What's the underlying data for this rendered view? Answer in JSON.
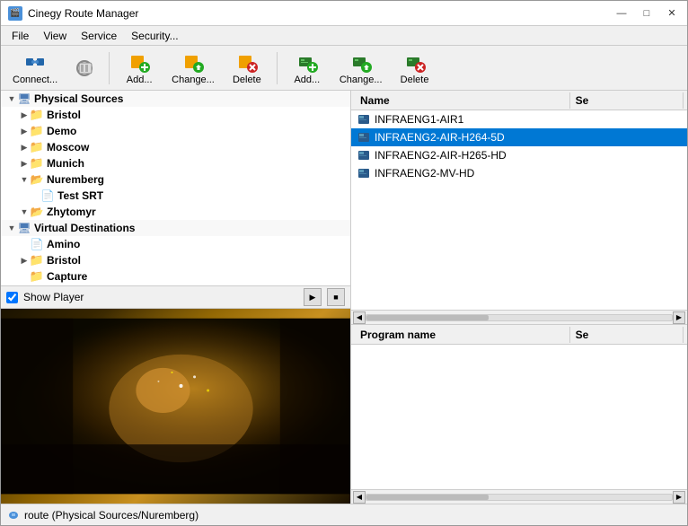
{
  "window": {
    "title": "Cinegy Route Manager",
    "icon": "🎬"
  },
  "titlebar_controls": {
    "minimize": "—",
    "maximize": "□",
    "close": "✕"
  },
  "menubar": {
    "items": [
      "File",
      "View",
      "Service",
      "Security..."
    ]
  },
  "toolbar": {
    "group1": [
      {
        "id": "connect",
        "label": "Connect...",
        "icon": "🔌"
      },
      {
        "id": "refresh",
        "label": "",
        "icon": "🔄"
      }
    ],
    "group2": [
      {
        "id": "add1",
        "label": "Add...",
        "icon": "➕"
      },
      {
        "id": "change1",
        "label": "Change...",
        "icon": "✏️"
      },
      {
        "id": "delete1",
        "label": "Delete",
        "icon": "🗑️"
      }
    ],
    "group3": [
      {
        "id": "add2",
        "label": "Add...",
        "icon": "➕"
      },
      {
        "id": "change2",
        "label": "Change...",
        "icon": "✏️"
      },
      {
        "id": "delete2",
        "label": "Delete",
        "icon": "🗑️"
      }
    ]
  },
  "tree": {
    "items": [
      {
        "id": "physical-sources",
        "label": "Physical Sources",
        "level": 0,
        "type": "root",
        "expanded": true
      },
      {
        "id": "bristol",
        "label": "Bristol",
        "level": 1,
        "type": "folder",
        "expanded": true
      },
      {
        "id": "demo",
        "label": "Demo",
        "level": 1,
        "type": "folder",
        "expanded": false
      },
      {
        "id": "moscow",
        "label": "Moscow",
        "level": 1,
        "type": "folder",
        "expanded": false
      },
      {
        "id": "munich",
        "label": "Munich",
        "level": 1,
        "type": "folder",
        "expanded": true
      },
      {
        "id": "nuremberg",
        "label": "Nuremberg",
        "level": 1,
        "type": "folder",
        "expanded": true,
        "selected": true
      },
      {
        "id": "test-srt",
        "label": "Test SRT",
        "level": 1,
        "type": "item",
        "expanded": false
      },
      {
        "id": "zhytomyr",
        "label": "Zhytomyr",
        "level": 1,
        "type": "folder",
        "expanded": true
      },
      {
        "id": "virtual-destinations",
        "label": "Virtual Destinations",
        "level": 0,
        "type": "root",
        "expanded": true
      },
      {
        "id": "amino",
        "label": "Amino",
        "level": 1,
        "type": "item",
        "expanded": false
      },
      {
        "id": "bristol2",
        "label": "Bristol",
        "level": 1,
        "type": "folder",
        "expanded": false
      },
      {
        "id": "capture",
        "label": "Capture",
        "level": 1,
        "type": "item",
        "expanded": false
      }
    ]
  },
  "show_player": {
    "label": "Show Player",
    "checked": true,
    "play_icon": "▶",
    "stop_icon": "■"
  },
  "right_panel": {
    "columns": [
      {
        "id": "name",
        "label": "Name"
      },
      {
        "id": "se",
        "label": "Se"
      }
    ],
    "items": [
      {
        "id": "infraeng1-air1",
        "label": "INFRAENG1-AIR1",
        "selected": false
      },
      {
        "id": "infraeng2-air-h264-5d",
        "label": "INFRAENG2-AIR-H264-5D",
        "selected": true
      },
      {
        "id": "infraeng2-air-h265-hd",
        "label": "INFRAENG2-AIR-H265-HD",
        "selected": false
      },
      {
        "id": "infraeng2-mv-hd",
        "label": "INFRAENG2-MV-HD",
        "selected": false
      }
    ]
  },
  "bottom_panel": {
    "columns": [
      {
        "id": "program-name",
        "label": "Program name"
      },
      {
        "id": "se2",
        "label": "Se"
      }
    ]
  },
  "statusbar": {
    "text": "route (Physical Sources/Nuremberg)"
  }
}
